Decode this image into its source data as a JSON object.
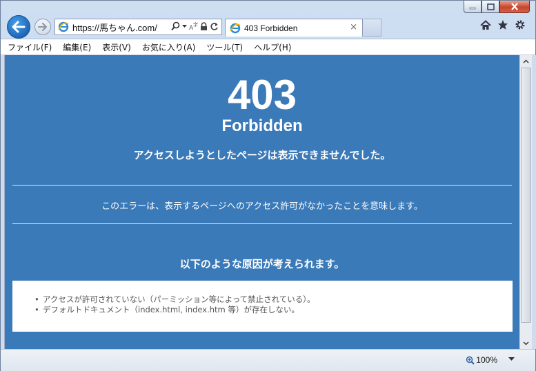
{
  "browser": {
    "address": "https://馬ちゃん.com/",
    "tab_title": "403 Forbidden",
    "tab_close": "×",
    "zoom_level": "100%"
  },
  "menu": [
    "ファイル(F)",
    "編集(E)",
    "表示(V)",
    "お気に入り(A)",
    "ツール(T)",
    "ヘルプ(H)"
  ],
  "page": {
    "code": "403",
    "status": "Forbidden",
    "message": "アクセスしようとしたページは表示できませんでした。",
    "description": "このエラーは、表示するページへのアクセス許可がなかったことを意味します。",
    "reasons_title": "以下のような原因が考えられます。",
    "reasons": [
      "アクセスが許可されていない（パーミッション等によって禁止されている）。",
      "デフォルトドキュメント（index.html, index.htm 等）が存在しない。"
    ]
  },
  "colors": {
    "page_background": "#3b7ab8",
    "text": "#ffffff"
  },
  "icons": [
    "back-arrow-icon",
    "forward-arrow-icon",
    "ie-icon",
    "search-icon",
    "dropdown-icon",
    "compatibility-icon",
    "lock-icon",
    "refresh-icon",
    "home-icon",
    "favorites-star-icon",
    "settings-gear-icon",
    "zoom-icon"
  ]
}
